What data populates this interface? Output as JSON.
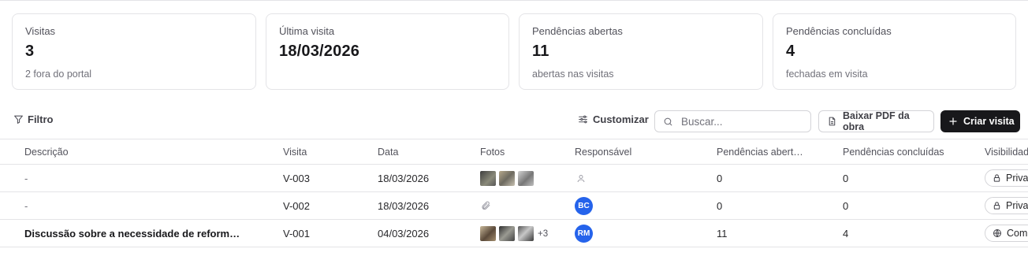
{
  "cards": [
    {
      "label": "Visitas",
      "value": "3",
      "sub": "2 fora do portal"
    },
    {
      "label": "Última visita",
      "value": "18/03/2026",
      "sub": ""
    },
    {
      "label": "Pendências abertas",
      "value": "11",
      "sub": "abertas nas visitas"
    },
    {
      "label": "Pendências concluídas",
      "value": "4",
      "sub": "fechadas em visita"
    }
  ],
  "toolbar": {
    "filter_label": "Filtro",
    "customize_label": "Customizar",
    "search_placeholder": "Buscar...",
    "pdf_label": "Baixar PDF da obra",
    "create_label": "Criar visita"
  },
  "columns": [
    "Descrição",
    "Visita",
    "Data",
    "Fotos",
    "Responsável",
    "Pendências abert…",
    "Pendências concluídas",
    "Visibilidad"
  ],
  "rows": [
    {
      "description": "-",
      "visit": "V-003",
      "date": "18/03/2026",
      "photos_extra": "",
      "responsible": "",
      "open": "0",
      "done": "0",
      "visibility": "Priva"
    },
    {
      "description": "-",
      "visit": "V-002",
      "date": "18/03/2026",
      "photos_extra": "",
      "responsible": "BC",
      "open": "0",
      "done": "0",
      "visibility": "Priva"
    },
    {
      "description": "Discussão sobre a necessidade de reform…",
      "visit": "V-001",
      "date": "04/03/2026",
      "photos_extra": "+3",
      "responsible": "RM",
      "open": "11",
      "done": "4",
      "visibility": "Com"
    }
  ],
  "colors": {
    "accent": "#18181b",
    "avatar": "#2563eb",
    "border": "#e4e4e7"
  }
}
